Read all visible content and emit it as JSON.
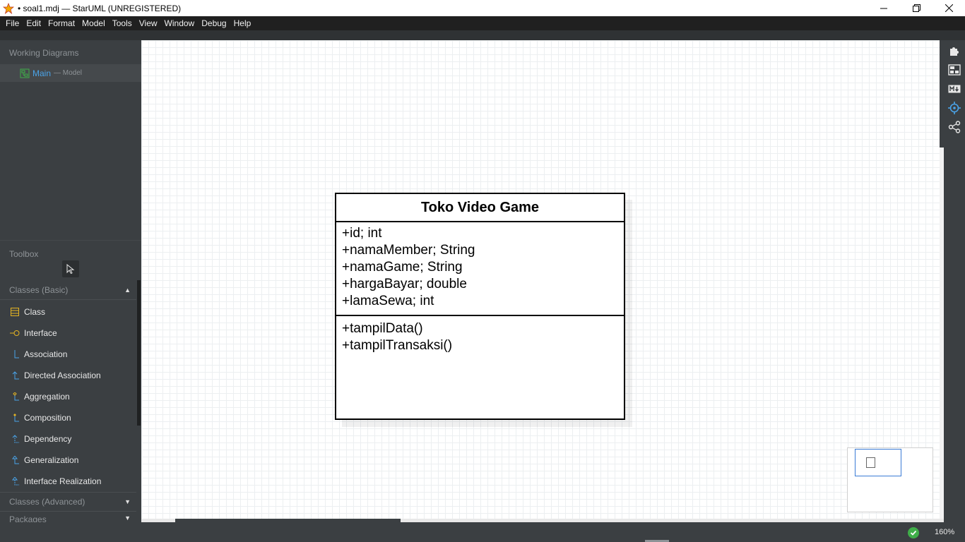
{
  "window": {
    "title": "• soal1.mdj — StarUML (UNREGISTERED)"
  },
  "menu": [
    "File",
    "Edit",
    "Format",
    "Model",
    "Tools",
    "View",
    "Window",
    "Debug",
    "Help"
  ],
  "sidebar": {
    "working_diagrams_header": "Working Diagrams",
    "diagram_name": "Main",
    "diagram_owner": "— Model"
  },
  "toolbox": {
    "header": "Toolbox",
    "section_basic": "Classes (Basic)",
    "section_advanced": "Classes (Advanced)",
    "section_next": "Packages",
    "tools": [
      "Class",
      "Interface",
      "Association",
      "Directed Association",
      "Aggregation",
      "Composition",
      "Dependency",
      "Generalization",
      "Interface Realization"
    ]
  },
  "uml_class": {
    "name": "Toko Video Game",
    "attributes": [
      "+id; int",
      "+namaMember; String",
      "+namaGame; String",
      "+hargaBayar; double",
      "+lamaSewa; int"
    ],
    "operations": [
      "+tampilData()",
      "+tampilTransaksi()"
    ]
  },
  "right_toolbar": [
    "extension-icon",
    "outline-icon",
    "markdown-icon",
    "navigator-icon",
    "share-icon"
  ],
  "status": {
    "zoom": "160%"
  },
  "colors": {
    "accent": "#4aa3e8",
    "panel": "#3b3f42",
    "menubar": "#202020",
    "status_ok": "#3fae49"
  }
}
